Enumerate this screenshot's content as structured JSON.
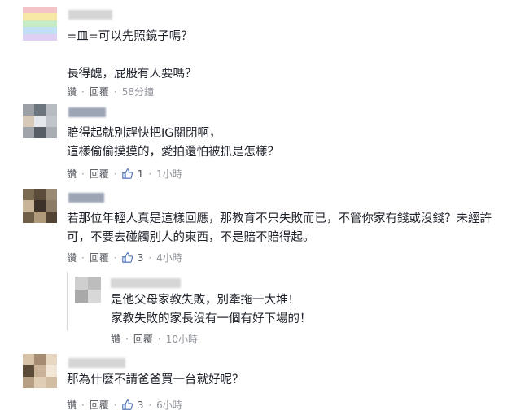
{
  "comments": [
    {
      "text": "=皿=可以先照鏡子嗎？\n\n長得醜，屁股有人要嗎？",
      "actions": {
        "reply_label": "讚",
        "comment_label": "回覆",
        "likes": "",
        "time": "58分鐘"
      }
    },
    {
      "text": "賠得起就別趕快把IG關閉啊，\n這樣偷偷摸摸的，愛拍還怕被抓是怎樣？",
      "actions": {
        "reply_label": "讚",
        "comment_label": "回覆",
        "likes": "1",
        "time": "1小時"
      }
    },
    {
      "text": "若那位年輕人真是這樣回應，那教育不只失敗而已，不管你家有錢或沒錢？未經許\n可，不要去碰觸別人的東西，不是賠不賠得起。",
      "actions": {
        "reply_label": "讚",
        "comment_label": "回覆",
        "likes": "3",
        "time": "4小時"
      }
    },
    {
      "text": "是他父母家教失敗，別牽拖一大堆！\n家教失敗的家長沒有一個有好下場的！",
      "actions": {
        "reply_label": "讚",
        "comment_label": "回覆",
        "likes": "",
        "time": "10小時"
      }
    },
    {
      "text": "那為什麼不請爸爸買一台就好呢？",
      "actions": {
        "reply_label": "讚",
        "comment_label": "回覆",
        "likes": "3",
        "time": "6小時"
      }
    }
  ],
  "icons": {
    "like": "thumbs-up-icon"
  },
  "colors": {
    "link": "#4b4f56",
    "time": "#90949c",
    "like_blue": "#4267b2"
  }
}
